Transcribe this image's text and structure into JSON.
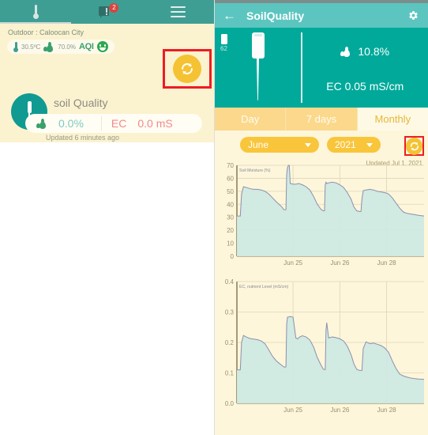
{
  "left_panel": {
    "navbar": {
      "thermo_icon": "thermometer-icon",
      "chat_icon": "chat-bubble-icon",
      "chat_badge": "2",
      "menu_icon": "hamburger-menu-icon"
    },
    "outdoor": {
      "label": "Outdoor : Caloocan City",
      "temperature": "30.5ºC",
      "humidity": "70.0%",
      "aqi_label": "AQI",
      "aqi_face": "smiley-happy-icon"
    },
    "refresh_button": {
      "icon": "refresh-icon",
      "highlighted": true
    },
    "soil_card": {
      "title": "soil Quality",
      "probe_icon": "soil-probe-icon",
      "moisture_value": "0.0%",
      "ec_label": "EC",
      "ec_value": "0.0 mS",
      "updated": "Updated 6 minutes ago"
    }
  },
  "right_panel": {
    "header": {
      "back_icon": "back-arrow-icon",
      "title": "SoilQuality",
      "settings_icon": "gear-icon"
    },
    "hero": {
      "battery_level": "62",
      "battery_icon": "battery-icon",
      "probe_icon": "soil-probe-icon",
      "moisture_icon": "water-drops-icon",
      "moisture_value": "10.8%",
      "ec_reading": "EC 0.05 mS/cm"
    },
    "tabs": [
      {
        "label": "Day",
        "active": false
      },
      {
        "label": "7 days",
        "active": false
      },
      {
        "label": "Monthly",
        "active": true
      }
    ],
    "pickers": {
      "month": "June",
      "year": "2021",
      "caret_icon": "chevron-down-icon"
    },
    "refresh_button": {
      "icon": "refresh-icon",
      "highlighted": true
    },
    "updated_on": "Updated Jul 1, 2021"
  },
  "colors": {
    "teal_header": "#5cc5c0",
    "teal_hero": "#00a99a",
    "left_nav": "#3f9e94",
    "cream_bg": "#fdf6da",
    "left_body_bg": "#fbf2cf",
    "accent_gold": "#f9c53b",
    "tab_inactive": "#fbd88b",
    "tab_active_text": "#e8b63a",
    "highlight_red": "#ee1c24",
    "chart_fill": "#cfe9e3",
    "chart_line": "#8d8fae",
    "ec_red": "#f08a8a",
    "moisture_teal": "#7ecbc2"
  },
  "chart_data": [
    {
      "type": "area",
      "title": "Soil Moisture (%)",
      "xlabel": "",
      "ylabel": "Soil Moisture (%)",
      "ylim": [
        0,
        70
      ],
      "yticks": [
        0,
        10,
        20,
        30,
        40,
        50,
        60,
        70
      ],
      "xticks": [
        "Jun 25",
        "Jun 26",
        "Jun 28"
      ],
      "xtick_positions": [
        0.3,
        0.55,
        0.8
      ],
      "grid": true,
      "legend": "none",
      "series": [
        {
          "name": "Soil Moisture (%)",
          "x": [
            0.0,
            0.012,
            0.018,
            0.025,
            0.035,
            0.05,
            0.07,
            0.09,
            0.11,
            0.13,
            0.15,
            0.17,
            0.19,
            0.21,
            0.225,
            0.24,
            0.25,
            0.258,
            0.262,
            0.266,
            0.27,
            0.275,
            0.28,
            0.285,
            0.3,
            0.315,
            0.33,
            0.35,
            0.37,
            0.39,
            0.41,
            0.43,
            0.45,
            0.462,
            0.468,
            0.472,
            0.476,
            0.48,
            0.49,
            0.51,
            0.53,
            0.55,
            0.57,
            0.59,
            0.61,
            0.625,
            0.64,
            0.655,
            0.663,
            0.668,
            0.675,
            0.69,
            0.71,
            0.73,
            0.75,
            0.77,
            0.79,
            0.81,
            0.83,
            0.85,
            0.87,
            0.89,
            0.91,
            0.93,
            0.95,
            0.97,
            1.0
          ],
          "y": [
            31,
            31,
            31,
            48,
            53.5,
            53,
            52,
            51.5,
            51.5,
            51,
            50,
            48,
            45,
            42,
            40,
            38,
            36,
            35.8,
            36,
            63,
            68,
            70,
            70,
            56,
            55.5,
            55.5,
            56,
            55,
            53.5,
            51,
            46,
            40,
            36,
            35,
            35,
            55,
            57,
            56,
            56.5,
            57,
            56.5,
            55,
            53,
            49,
            44,
            38,
            35,
            34.5,
            34.5,
            44,
            50.5,
            51,
            51.5,
            51,
            50,
            49.5,
            49,
            48,
            45,
            41,
            37,
            34,
            33,
            32.5,
            32,
            31.5,
            31
          ]
        }
      ]
    },
    {
      "type": "area",
      "title": "EC, nutrient Level (mS/cm)",
      "xlabel": "",
      "ylabel": "EC, nutrient Level (mS/cm)",
      "ylim": [
        0.0,
        0.4
      ],
      "yticks": [
        0.0,
        0.1,
        0.2,
        0.3,
        0.4
      ],
      "xticks": [
        "Jun 25",
        "Jun 26",
        "Jun 28"
      ],
      "xtick_positions": [
        0.3,
        0.55,
        0.8
      ],
      "grid": true,
      "legend": "none",
      "series": [
        {
          "name": "EC, nutrient Level (mS/cm)",
          "x": [
            0.0,
            0.012,
            0.018,
            0.025,
            0.035,
            0.05,
            0.07,
            0.09,
            0.11,
            0.13,
            0.15,
            0.17,
            0.19,
            0.21,
            0.225,
            0.24,
            0.25,
            0.258,
            0.262,
            0.266,
            0.27,
            0.285,
            0.3,
            0.315,
            0.325,
            0.335,
            0.35,
            0.37,
            0.39,
            0.41,
            0.43,
            0.45,
            0.462,
            0.468,
            0.472,
            0.476,
            0.48,
            0.49,
            0.51,
            0.53,
            0.55,
            0.57,
            0.59,
            0.61,
            0.625,
            0.64,
            0.655,
            0.663,
            0.668,
            0.675,
            0.69,
            0.71,
            0.73,
            0.75,
            0.77,
            0.79,
            0.81,
            0.83,
            0.85,
            0.87,
            0.89,
            0.91,
            0.93,
            0.95,
            0.97,
            1.0
          ],
          "y": [
            0.11,
            0.11,
            0.11,
            0.2,
            0.223,
            0.218,
            0.213,
            0.211,
            0.209,
            0.205,
            0.196,
            0.176,
            0.155,
            0.14,
            0.132,
            0.125,
            0.12,
            0.119,
            0.12,
            0.26,
            0.283,
            0.285,
            0.283,
            0.215,
            0.212,
            0.218,
            0.222,
            0.218,
            0.208,
            0.185,
            0.15,
            0.125,
            0.112,
            0.111,
            0.111,
            0.24,
            0.265,
            0.215,
            0.218,
            0.216,
            0.212,
            0.205,
            0.188,
            0.16,
            0.13,
            0.112,
            0.108,
            0.108,
            0.108,
            0.18,
            0.202,
            0.196,
            0.198,
            0.194,
            0.19,
            0.182,
            0.168,
            0.14,
            0.115,
            0.096,
            0.09,
            0.086,
            0.083,
            0.081,
            0.08,
            0.079
          ]
        }
      ]
    }
  ]
}
